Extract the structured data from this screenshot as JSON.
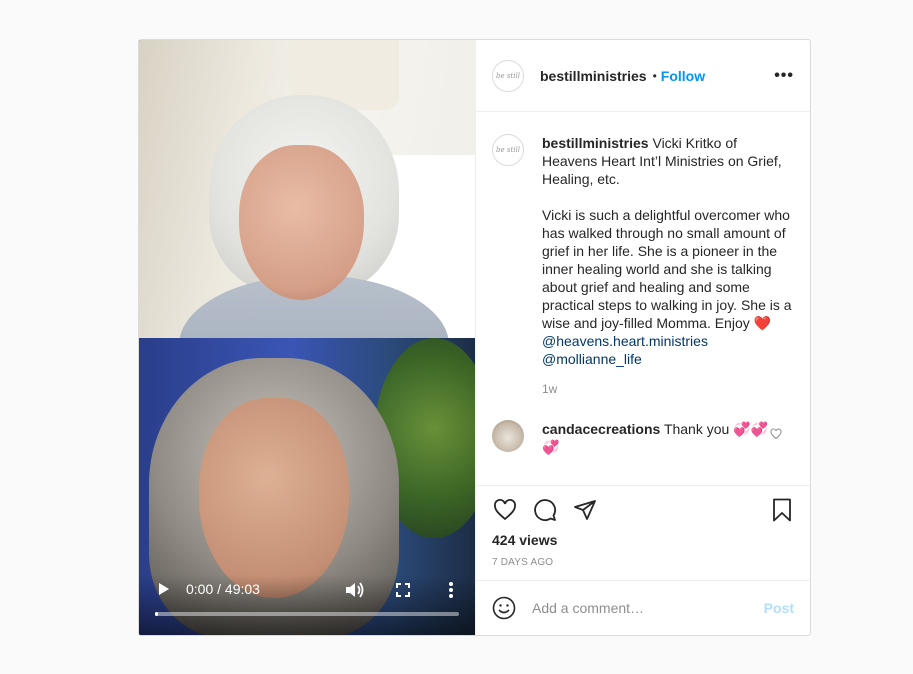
{
  "post": {
    "author": "bestillministries",
    "avatar_label": "be still",
    "dot": "•",
    "follow_label": "Follow",
    "more_label": "•••"
  },
  "video": {
    "timecode": "0:00 / 49:03",
    "progress": 0.01
  },
  "caption": {
    "username": "bestillministries",
    "line1": "Vicki Kritko of Heavens Heart Int’l Ministries on Grief, Healing, etc.",
    "line2": "Vicki is such a delightful overcomer who has walked through no small amount of grief in her life. She is a pioneer in the inner healing world and she is talking about grief and healing and some practical steps to walking in joy. She is a wise and joy-filled Momma. Enjoy",
    "emoji": "❤️",
    "mention1": "@heavens.heart.ministries",
    "mention2": "@mollianne_life",
    "time_ago": "1w"
  },
  "comments": [
    {
      "username": "candacecreations",
      "text": "Thank you",
      "emoji": "💞💞💞"
    }
  ],
  "stats": {
    "views": "424 views",
    "date": "7 DAYS AGO"
  },
  "add_comment": {
    "placeholder": "Add a comment…",
    "post_label": "Post"
  },
  "icons": [
    "play-icon",
    "volume-icon",
    "fullscreen-icon",
    "more-vert-icon",
    "more-icon",
    "heart-icon",
    "comment-icon",
    "share-icon",
    "bookmark-icon",
    "emoji-icon"
  ]
}
